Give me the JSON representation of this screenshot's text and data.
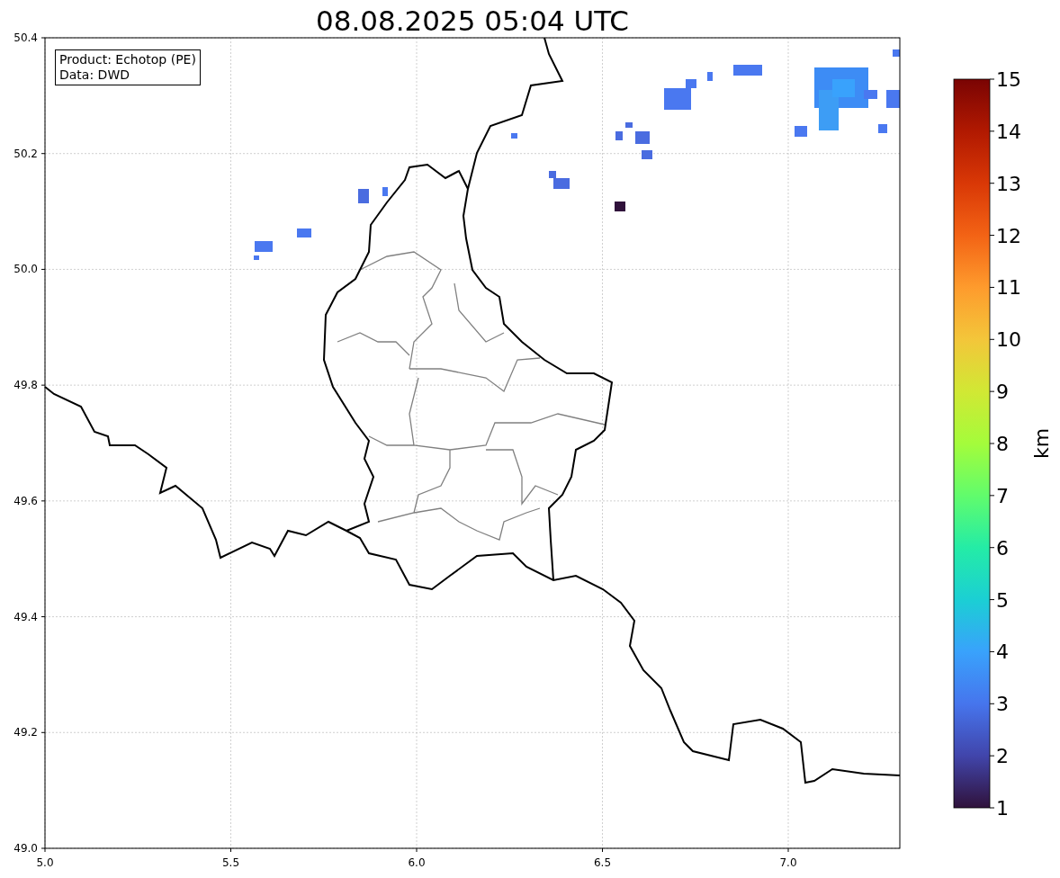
{
  "title": "08.08.2025 05:04 UTC",
  "info_box": {
    "lines": [
      "Product: Echotop (PE)",
      "Data: DWD"
    ]
  },
  "x_ticks": [
    "5.0",
    "5.5",
    "6.0",
    "6.5",
    "7.0"
  ],
  "y_ticks": [
    "50.4",
    "50.2",
    "50.0",
    "49.8",
    "49.6",
    "49.4",
    "49.2",
    "49.0"
  ],
  "colorbar": {
    "label": "km",
    "ticks": [
      "15",
      "14",
      "13",
      "12",
      "11",
      "10",
      "9",
      "8",
      "7",
      "6",
      "5",
      "4",
      "3",
      "2",
      "1"
    ]
  }
}
